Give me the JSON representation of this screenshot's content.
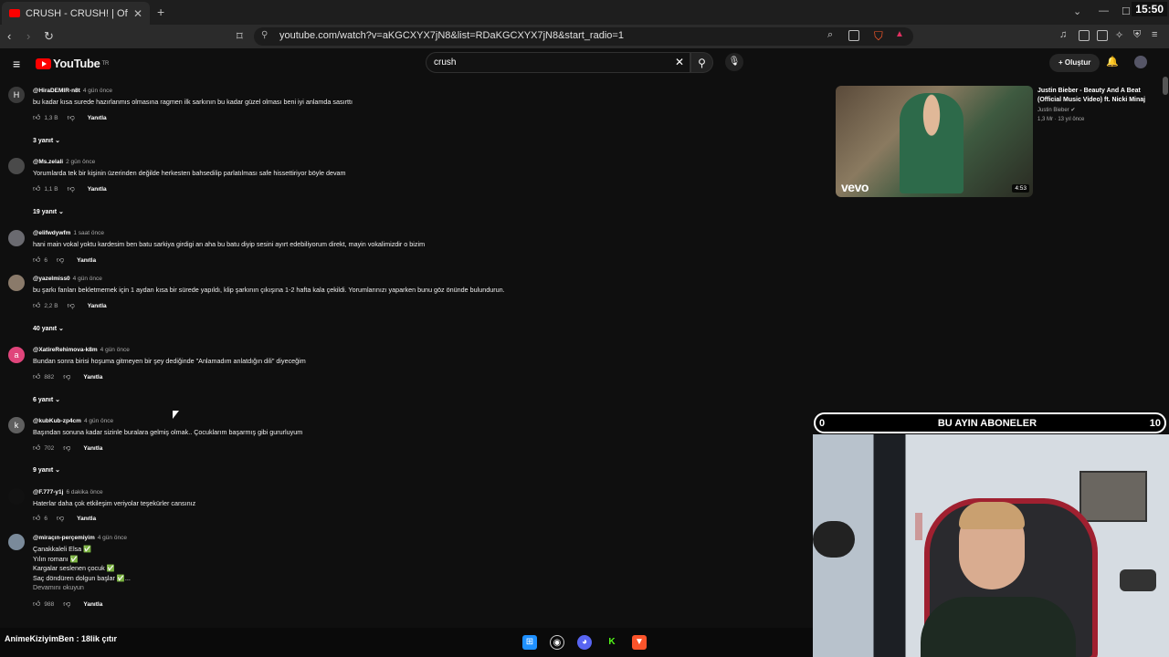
{
  "browser": {
    "tab_title": "CRUSH - CRUSH! | Official Music",
    "tab_close": "✕",
    "new_tab": "+",
    "url": "youtube.com/watch?v=aKGCXYX7jN8&list=RDaKGCXYX7jN8&start_radio=1",
    "clock": "15:50"
  },
  "youtube": {
    "logo": "YouTube",
    "logo_region": "TR",
    "search_value": "crush",
    "create_label": "+ Oluştur"
  },
  "comments": [
    {
      "author": "@HiraDEMIR-n8t",
      "time": "4 gün önce",
      "lines": [
        "bu kadar kısa surede hazırlanmıs olmasına ragmen ilk sarkının bu kadar güzel olması beni iyi anlamda sasırttı"
      ],
      "likes": "1,3 B",
      "reply": "Yanıtla",
      "replies": "3 yanıt",
      "avatar_letter": "H",
      "avatar_color": "#3a3a3a"
    },
    {
      "author": "@Ms.zelali",
      "time": "2 gün önce",
      "lines": [
        "Yorumlarda tek bir kişinin üzerinden değilde herkesten bahsedilip parlatılması safe hissettiriyor böyle devam"
      ],
      "likes": "1,1 B",
      "reply": "Yanıtla",
      "replies": "19 yanıt",
      "avatar_letter": "",
      "avatar_color": "#4a4a4a"
    },
    {
      "author": "@elifwdywfm",
      "time": "1 saat önce",
      "lines": [
        "hani main vokal yoktu kardesim ben batu sarkiya girdigi an aha bu batu diyip sesini ayırt edebiliyorum direkt, mayin vokalimizdir o bizim"
      ],
      "likes": "6",
      "reply": "Yanıtla",
      "replies": "",
      "avatar_letter": "",
      "avatar_color": "#6a6a70"
    },
    {
      "author": "@yazelmiss0",
      "time": "4 gün önce",
      "lines": [
        "bu şarkı fanları bekletmemek için 1 aydan kısa bir sürede yapıldı, klip şarkının çıkışına 1-2 hafta kala çekildi. Yorumlarınızı yaparken bunu göz önünde bulundurun."
      ],
      "likes": "2,2 B",
      "reply": "Yanıtla",
      "replies": "40 yanıt",
      "avatar_letter": "",
      "avatar_color": "#8a7a6a"
    },
    {
      "author": "@XatireRehimova-k8m",
      "time": "4 gün önce",
      "lines": [
        "Bundan sonra birisi hoşuma gitmeyen bir şey dediğinde \"Anlamadım anlatdığın dili\" diyeceğim"
      ],
      "likes": "882",
      "reply": "Yanıtla",
      "replies": "6 yanıt",
      "avatar_letter": "a",
      "avatar_color": "#e0457b"
    },
    {
      "author": "@kubKub-zp4cm",
      "time": "4 gün önce",
      "lines": [
        "Başından sonuna kadar sizinle buralara gelmiş olmak.. Çocuklarım başarmış gibi gururluyum"
      ],
      "likes": "702",
      "reply": "Yanıtla",
      "replies": "9 yanıt",
      "avatar_letter": "k",
      "avatar_color": "#5f5f5f"
    },
    {
      "author": "@F.777-y1j",
      "time": "6 dakika önce",
      "lines": [
        "Haterlar daha çok etkileşim veriyolar teşekürler cansınız"
      ],
      "likes": "6",
      "reply": "Yanıtla",
      "replies": "",
      "avatar_letter": "",
      "avatar_color": "#111111"
    },
    {
      "author": "@miraçın-perçemiyim",
      "time": "4 gün önce",
      "lines": [
        "Çanakkaleli Elsa ✅",
        "Yılın romanı ✅",
        "Kargalar seslenen çocuk ✅",
        "Saç döndüren dolgun başlar ✅..."
      ],
      "more": "Devamını okuyun",
      "likes": "988",
      "reply": "Yanıtla",
      "replies": "",
      "avatar_letter": "",
      "avatar_color": "#7a8a9a"
    }
  ],
  "recommended": {
    "title": "Justin Bieber - Beauty And A Beat (Official Music Video) ft. Nicki Minaj",
    "channel": "Justin Bieber",
    "meta": "1,3 Mr · 13 yıl önce",
    "duration": "4:53",
    "badge": "vevo"
  },
  "overlay": {
    "banner_left": "0",
    "banner_title": "BU AYIN ABONELER",
    "banner_right": "10",
    "bottom_label": "AnimeKiziyimBen : 18lik çıtır"
  }
}
